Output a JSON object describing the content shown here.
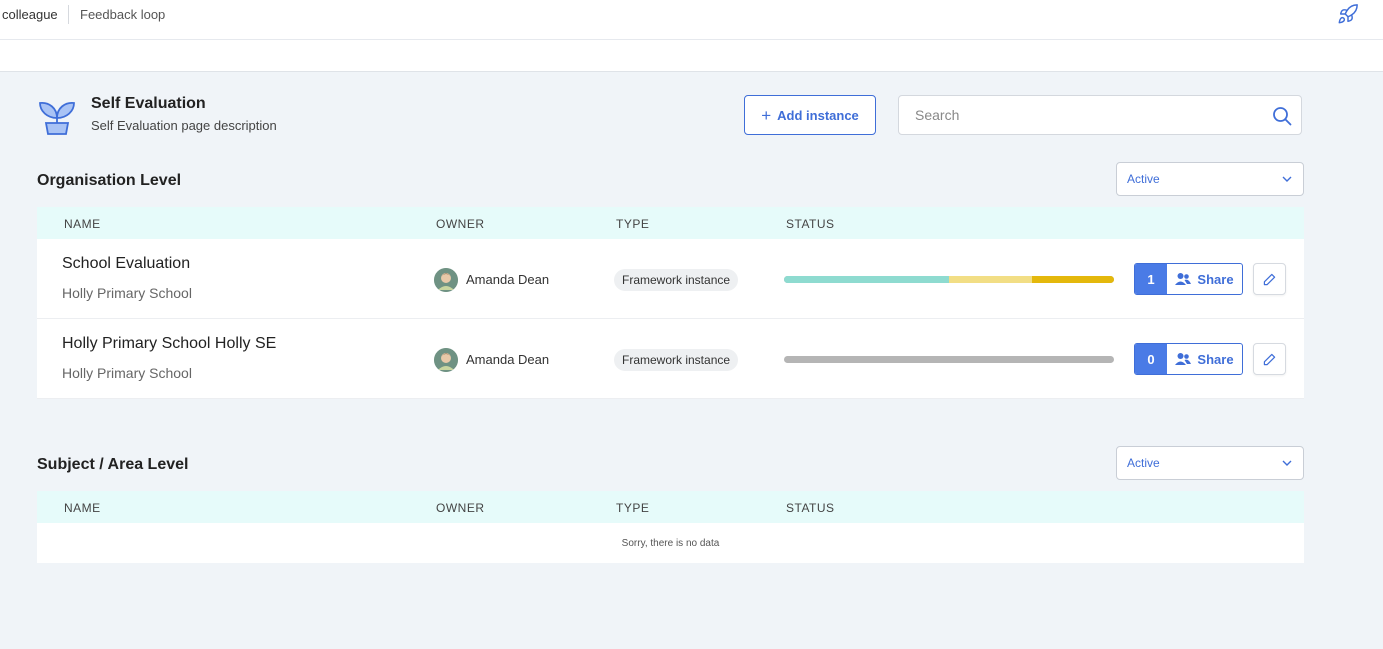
{
  "topbar": {
    "crumb1": "colleague",
    "crumb2": "Feedback loop",
    "rocket_icon": "rocket-icon"
  },
  "page": {
    "title": "Self Evaluation",
    "description": "Self Evaluation page description",
    "icon": "plant-icon"
  },
  "toolbar": {
    "add_label": "Add instance",
    "search_placeholder": "Search",
    "search_value": ""
  },
  "columns": {
    "name": "NAME",
    "owner": "OWNER",
    "type": "TYPE",
    "status": "STATUS"
  },
  "sections": [
    {
      "title": "Organisation Level",
      "filter": "Active",
      "rows": [
        {
          "name": "School Evaluation",
          "school": "Holly Primary School",
          "owner": "Amanda Dean",
          "type": "Framework instance",
          "status_segments": [
            {
              "fraction": 0.5,
              "color": "#8edbd0"
            },
            {
              "fraction": 0.25,
              "color": "#f2de85"
            },
            {
              "fraction": 0.25,
              "color": "#e4b80c"
            }
          ],
          "share_count": "1",
          "share_label": "Share"
        },
        {
          "name": "Holly Primary School Holly SE",
          "school": "Holly Primary School",
          "owner": "Amanda Dean",
          "type": "Framework instance",
          "status_segments": [
            {
              "fraction": 1.0,
              "color": "#b5b5b5"
            }
          ],
          "share_count": "0",
          "share_label": "Share"
        }
      ]
    },
    {
      "title": "Subject / Area Level",
      "filter": "Active",
      "empty_text": "Sorry, there is no data"
    }
  ],
  "colors": {
    "accent": "#3f6ed8",
    "table_header_bg": "#e6fbfa",
    "page_bg": "#f0f4f8"
  }
}
